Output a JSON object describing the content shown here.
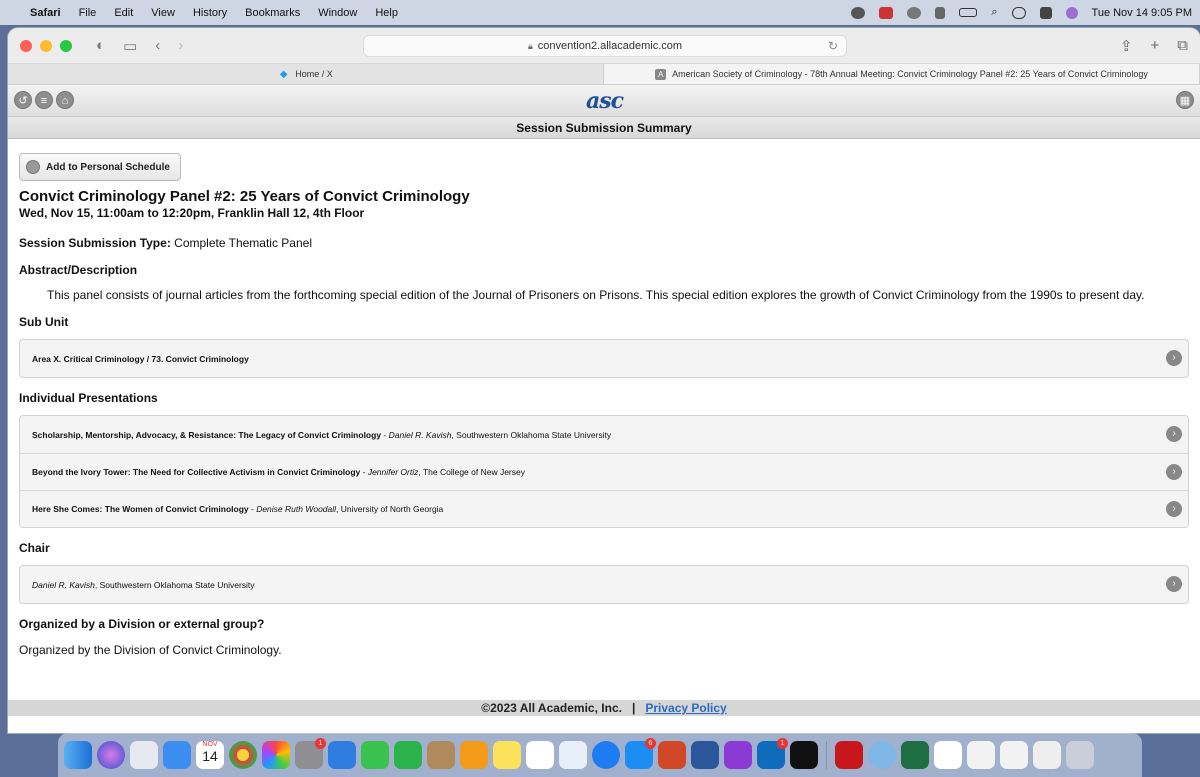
{
  "menubar": {
    "app": "Safari",
    "menus": [
      "File",
      "Edit",
      "View",
      "History",
      "Bookmarks",
      "Window",
      "Help"
    ],
    "clock": "Tue Nov 14  9:05 PM"
  },
  "browser": {
    "url": "convention2.allacademic.com",
    "tabs": [
      {
        "label": "Home / X",
        "active": false
      },
      {
        "label": "American Society of Criminology - 78th Annual Meeting: Convict Criminology Panel #2: 25 Years of Convict Criminology",
        "active": true
      }
    ]
  },
  "page": {
    "logo": "asc",
    "header_title": "Session Submission Summary",
    "schedule_button": "Add to Personal Schedule",
    "session_title": "Convict Criminology Panel #2: 25 Years of Convict Criminology",
    "session_when": "Wed, Nov 15, 11:00am to 12:20pm, Franklin Hall 12, 4th Floor",
    "submission_type_label": "Session Submission Type:",
    "submission_type_value": " Complete Thematic Panel",
    "abstract_heading": "Abstract/Description",
    "abstract_text": "This panel consists of journal articles from the forthcoming special edition of the Journal of Prisoners on Prisons. This special edition explores the growth of Convict Criminology from the 1990s to present day.",
    "subunit_heading": "Sub Unit",
    "subunit": "Area X. Critical Criminology / 73. Convict Criminology",
    "presentations_heading": "Individual Presentations",
    "presentations": [
      {
        "title": "Scholarship, Mentorship, Advocacy, & Resistance: The Legacy of Convict Criminology",
        "author": "Daniel R. Kavish",
        "affiliation": ", Southwestern Oklahoma State University"
      },
      {
        "title": "Beyond the Ivory Tower: The Need for Collective Activism in Convict Criminology",
        "author": "Jennifer Ortiz",
        "affiliation": ", The College of New Jersey"
      },
      {
        "title": "Here She Comes: The Women of Convict Criminology",
        "author": "Denise Ruth Woodall",
        "affiliation": ", University of North Georgia"
      }
    ],
    "chair_heading": "Chair",
    "chair_name": "Daniel R. Kavish",
    "chair_affiliation": ", Southwestern Oklahoma State University",
    "organized_heading": "Organized by a Division or external group?",
    "organized_text": "Organized by the Division of Convict Criminology.",
    "footer_copyright": "©2023 All Academic, Inc.",
    "footer_sep": "|",
    "footer_link": "Privacy Policy"
  },
  "dock": {
    "calendar_month": "NOV",
    "calendar_day": "14",
    "badges": [
      "1",
      "6",
      "1"
    ]
  },
  "colors": {
    "logo_blue": "#1f4f99",
    "link_blue": "#2a6bbd"
  }
}
